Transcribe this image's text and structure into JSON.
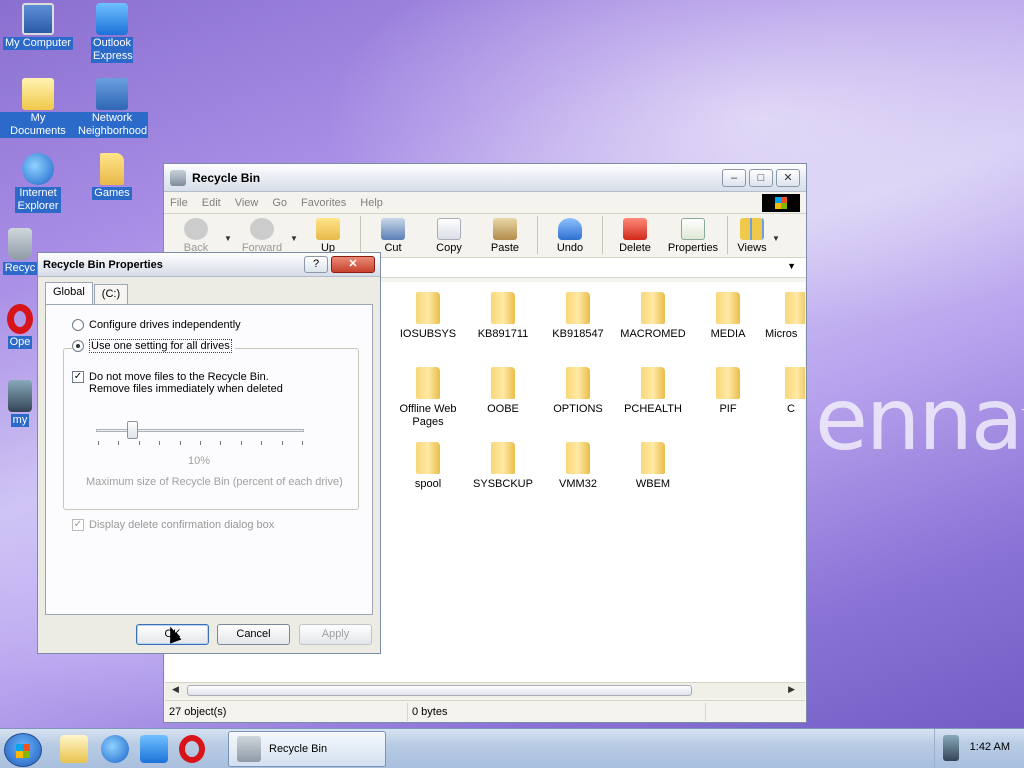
{
  "desktop": {
    "icons": [
      {
        "label": "My Computer"
      },
      {
        "label": "Outlook Express"
      },
      {
        "label": "My Documents"
      },
      {
        "label": "Network Neighborhood"
      },
      {
        "label": "Internet Explorer"
      },
      {
        "label": "Games"
      },
      {
        "label": "Recyc"
      },
      {
        "label": "Ope"
      },
      {
        "label": "my"
      }
    ],
    "watermark": "enna"
  },
  "explorer": {
    "title": "Recycle Bin",
    "controls": {
      "minimize": "–",
      "maximize": "□",
      "close": "✕"
    },
    "menu": [
      "File",
      "Edit",
      "View",
      "Go",
      "Favorites",
      "Help"
    ],
    "toolbar": {
      "back": "Back",
      "forward": "Forward",
      "up": "Up",
      "cut": "Cut",
      "copy": "Copy",
      "paste": "Paste",
      "undo": "Undo",
      "delete": "Delete",
      "properties": "Properties",
      "views": "Views"
    },
    "folders": [
      "IOSUBSYS",
      "KB891711",
      "KB918547",
      "MACROMED",
      "MEDIA",
      "Micros",
      "Offline Web Pages",
      "OOBE",
      "OPTIONS",
      "PCHEALTH",
      "PIF",
      "C",
      "spool",
      "SYSBCKUP",
      "VMM32",
      "WBEM"
    ],
    "status": {
      "objects": "27 object(s)",
      "size": "0 bytes"
    }
  },
  "dialog": {
    "title": "Recycle Bin Properties",
    "help": "?",
    "close": "✕",
    "tabs": [
      "Global",
      "(C:)"
    ],
    "radio_independent": "Configure drives independently",
    "radio_one_setting": "Use one setting for all drives",
    "checkbox_no_move_line1": "Do not move files to the Recycle Bin.",
    "checkbox_no_move_line2": "Remove files immediately when deleted",
    "slider_value": "10%",
    "slider_fraction": 0.1,
    "slider_caption": "Maximum size of Recycle Bin (percent of each drive)",
    "checkbox_confirm": "Display delete confirmation dialog box",
    "check_mark": "✓",
    "buttons": {
      "ok": "OK",
      "cancel": "Cancel",
      "apply": "Apply"
    }
  },
  "taskbar": {
    "task_label": "Recycle Bin",
    "clock": "1:42 AM"
  }
}
